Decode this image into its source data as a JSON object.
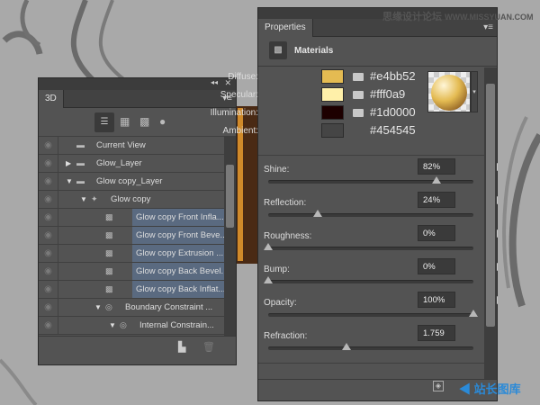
{
  "watermark": "思缘设计论坛 WWW.MISSYUAN.COM",
  "corner_logo": "站长图库",
  "panel3d": {
    "tab": "3D",
    "collapse_icon": "◂◂",
    "close_icon": "✕",
    "menu_icon": "▾≡",
    "filter_icons": [
      "scene-icon",
      "mesh-icon",
      "material-icon",
      "light-icon"
    ],
    "rows": [
      {
        "label": "Current View",
        "indent": 0,
        "twisty": "",
        "icon": "camera-icon",
        "selected": false
      },
      {
        "label": "Glow_Layer",
        "indent": 0,
        "twisty": "▶",
        "icon": "folder-icon",
        "selected": false
      },
      {
        "label": "Glow copy_Layer",
        "indent": 0,
        "twisty": "▼",
        "icon": "folder-icon",
        "selected": false
      },
      {
        "label": "Glow copy",
        "indent": 1,
        "twisty": "▼",
        "icon": "mesh-icon",
        "selected": false
      },
      {
        "label": "Glow copy Front Infla...",
        "indent": 2,
        "twisty": "",
        "icon": "material-icon",
        "selected": true
      },
      {
        "label": "Glow copy Front Beve...",
        "indent": 2,
        "twisty": "",
        "icon": "material-icon",
        "selected": true
      },
      {
        "label": "Glow copy Extrusion ...",
        "indent": 2,
        "twisty": "",
        "icon": "material-icon",
        "selected": true
      },
      {
        "label": "Glow copy Back Bevel...",
        "indent": 2,
        "twisty": "",
        "icon": "material-icon",
        "selected": true
      },
      {
        "label": "Glow copy Back Inflat...",
        "indent": 2,
        "twisty": "",
        "icon": "material-icon",
        "selected": true
      },
      {
        "label": "Boundary Constraint ...",
        "indent": 2,
        "twisty": "▼",
        "icon": "constraint-icon",
        "selected": false
      },
      {
        "label": "Internal Constrain...",
        "indent": 3,
        "twisty": "▼",
        "icon": "constraint-icon",
        "selected": false
      }
    ]
  },
  "properties": {
    "tab": "Properties",
    "menu_icon": "▾≡",
    "section": "Materials",
    "colors": [
      {
        "label": "Diffuse:",
        "hex": "#e4bb52",
        "swatch": "#e4bb52",
        "texture": true
      },
      {
        "label": "Specular:",
        "hex": "#fff0a9",
        "swatch": "#fff0a9",
        "texture": true
      },
      {
        "label": "Illumination:",
        "hex": "#1d0000",
        "swatch": "#1d0000",
        "texture": true
      },
      {
        "label": "Ambient:",
        "hex": "#454545",
        "swatch": "#454545",
        "texture": false
      }
    ],
    "sliders": [
      {
        "label": "Shine:",
        "value": "82%",
        "fraction": 0.82,
        "texture": true
      },
      {
        "label": "Reflection:",
        "value": "24%",
        "fraction": 0.24,
        "texture": true
      },
      {
        "label": "Roughness:",
        "value": "0%",
        "fraction": 0,
        "texture": true
      },
      {
        "label": "Bump:",
        "value": "0%",
        "fraction": 0,
        "texture": true
      },
      {
        "label": "Opacity:",
        "value": "100%",
        "fraction": 1,
        "texture": true
      },
      {
        "label": "Refraction:",
        "value": "1.759",
        "fraction": 0.38,
        "texture": false
      }
    ]
  }
}
